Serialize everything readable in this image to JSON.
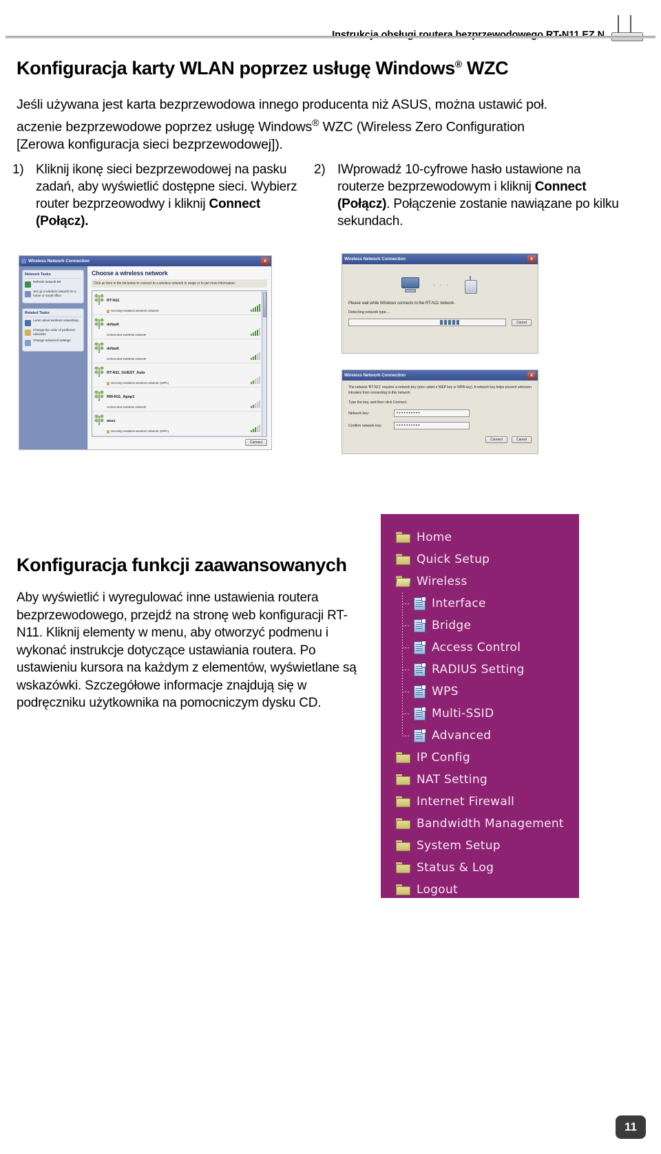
{
  "header": {
    "title": "Instrukcja obsługi routera bezprzewodowego RT-N11 EZ N",
    "router_icon": "wireless-router-icon"
  },
  "wzc_section": {
    "heading_before": "Konfiguracja karty WLAN poprzez usługę Windows",
    "heading_sup": "®",
    "heading_after": " WZC",
    "intro": "Jeśli używana jest karta bezprzewodowa innego producenta niż ASUS, można ustawić poł. aczenie bezprzewodowe poprzez usługę Windows® WZC (Wireless Zero Configuration [Zerowa konfiguracja sieci bezprzewodowej]).",
    "intro_line1": "Jeśli używana jest karta bezprzewodowa innego producenta niż ASUS, można ustawić poł.",
    "intro_line2_a": "aczenie bezprzewodowe poprzez usługę Windows",
    "intro_line2_sup": "®",
    "intro_line2_b": " WZC (Wireless Zero Configuration",
    "intro_line3": "[Zerowa konfiguracja sieci bezprzewodowej])."
  },
  "steps": [
    {
      "number": "1)",
      "text_plain": "Kliknij ikonę sieci bezprzewodowej na pasku zadań, aby wyświetlić dostępne sieci. Wybierz router bezprzeowodwy i kliknij Connect (Połącz).",
      "text_before": "Kliknij ikonę sieci bezprzewodowej na pasku zadań, aby wyświetlić dostępne sieci. Wybierz router bezprzeowodwy i kliknij ",
      "text_bold": "Connect (Połącz).",
      "text_after": ""
    },
    {
      "number": "2)",
      "text_plain": "IWprowadź 10-cyfrowe hasło ustawione na routerze bezprzewodowym i kliknij Connect (Połącz). Połączenie zostanie nawiązane po kilku sekundach.",
      "text_before": "IWprowadź 10-cyfrowe hasło ustawione na routerze bezprzewodowym i kliknij ",
      "text_bold": "Connect (Połącz)",
      "text_after": ". Połączenie zostanie nawiązane po kilku sekundach."
    }
  ],
  "screenshot_available_networks": {
    "window_title": "Wireless Network Connection",
    "close_label": "x",
    "content_heading": "Choose a wireless network",
    "content_sub": "Click an item in the list below to connect to a wireless network in range or to get more information.",
    "panels": [
      {
        "title": "Network Tasks",
        "tasks": [
          "Refresh network list",
          "Set up a wireless network for a home or small office"
        ]
      },
      {
        "title": "Related Tasks",
        "tasks": [
          "Learn about wireless networking",
          "Change the order of preferred networks",
          "Change advanced settings"
        ]
      }
    ],
    "networks": [
      {
        "ssid": "RT-N11",
        "security": "Security-enabled wireless network",
        "locked": true,
        "signal": 4
      },
      {
        "ssid": "default",
        "security": "Unsecured wireless network",
        "locked": false,
        "signal": 4
      },
      {
        "ssid": "default",
        "security": "Unsecured wireless network",
        "locked": false,
        "signal": 3
      },
      {
        "ssid": "RT-N11_GUEST_Auto",
        "security": "Security-enabled wireless network (WPA)",
        "locked": true,
        "signal": 2
      },
      {
        "ssid": "RW-N11_Agnp1",
        "security": "Unsecured wireless network",
        "locked": false,
        "signal": 2
      },
      {
        "ssid": "asus",
        "security": "Security-enabled wireless network (WPA)",
        "locked": true,
        "signal": 3
      }
    ],
    "connect_button": "Connect"
  },
  "screenshot_connecting": {
    "window_title": "Wireless Network Connection",
    "close_label": "x",
    "message": "Please wait while Windows connects to the RT-N11 network.",
    "status": "Detecting network type...",
    "cancel_button": "Cancel"
  },
  "screenshot_network_key": {
    "window_title": "Wireless Network Connection",
    "close_label": "x",
    "description": "The network 'RT-N11' requires a network key (also called a WEP key or WPA key). A network key helps prevent unknown intruders from connecting to this network.",
    "prompt": "Type the key, and then click Connect.",
    "fields": [
      {
        "label": "Network key:",
        "value": "••••••••••"
      },
      {
        "label": "Confirm network key:",
        "value": "••••••••••"
      }
    ],
    "buttons": [
      "Connect",
      "Cancel"
    ]
  },
  "advanced_section": {
    "heading": "Konfiguracja funkcji zaawansowanych",
    "paragraph": "Aby wyświetlić i wyregulować inne ustawienia routera bezprzewodowego, przejdź na stronę web konfiguracji RT-N11. Kliknij elementy w menu, aby otworzyć podmenu i wykonać instrukcje dotyczące ustawiania routera. Po ustawieniu kursora na każdym z elementów, wyświetlane są wskazówki. Szczegółowe informacje znajdują się w podręczniku użytkownika na pomocniczym dysku CD."
  },
  "web_menu": {
    "background_color": "#8e2272",
    "items": [
      {
        "label": "Home",
        "icon": "folder-icon",
        "level": 0,
        "state": "closed"
      },
      {
        "label": "Quick Setup",
        "icon": "folder-icon",
        "level": 0,
        "state": "closed"
      },
      {
        "label": "Wireless",
        "icon": "folder-open-icon",
        "level": 0,
        "state": "open"
      },
      {
        "label": "Interface",
        "icon": "document-icon",
        "level": 1,
        "state": "leaf"
      },
      {
        "label": "Bridge",
        "icon": "document-icon",
        "level": 1,
        "state": "leaf"
      },
      {
        "label": "Access Control",
        "icon": "document-icon",
        "level": 1,
        "state": "leaf"
      },
      {
        "label": "RADIUS Setting",
        "icon": "document-icon",
        "level": 1,
        "state": "leaf"
      },
      {
        "label": "WPS",
        "icon": "document-icon",
        "level": 1,
        "state": "leaf"
      },
      {
        "label": "Multi-SSID",
        "icon": "document-icon",
        "level": 1,
        "state": "leaf"
      },
      {
        "label": "Advanced",
        "icon": "document-icon",
        "level": 1,
        "state": "leaf-last"
      },
      {
        "label": "IP Config",
        "icon": "folder-icon",
        "level": 0,
        "state": "closed"
      },
      {
        "label": "NAT Setting",
        "icon": "folder-icon",
        "level": 0,
        "state": "closed"
      },
      {
        "label": "Internet Firewall",
        "icon": "folder-icon",
        "level": 0,
        "state": "closed"
      },
      {
        "label": "Bandwidth Management",
        "icon": "folder-icon",
        "level": 0,
        "state": "closed"
      },
      {
        "label": "System Setup",
        "icon": "folder-icon",
        "level": 0,
        "state": "closed"
      },
      {
        "label": "Status & Log",
        "icon": "folder-icon",
        "level": 0,
        "state": "closed"
      },
      {
        "label": "Logout",
        "icon": "folder-icon",
        "level": 0,
        "state": "closed"
      }
    ]
  },
  "footer": {
    "page_number": "11"
  }
}
